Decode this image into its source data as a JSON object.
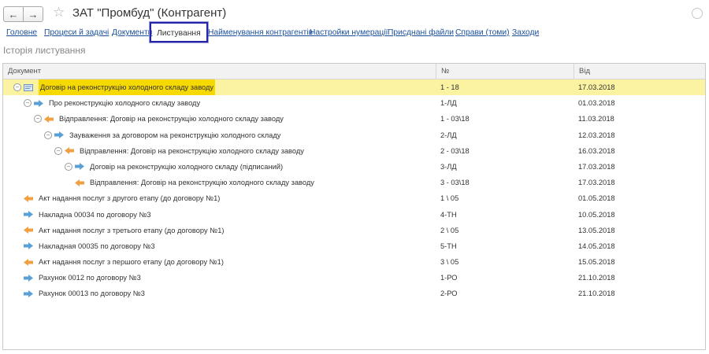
{
  "window": {
    "title": "ЗАТ \"Промбуд\" (Контрагент)",
    "back_icon": "arrow-left-icon",
    "forward_icon": "arrow-right-icon",
    "favorite_icon": "star-icon"
  },
  "tabs": [
    {
      "label": "Головне",
      "active": false
    },
    {
      "label": "Процеси й задачі",
      "active": false
    },
    {
      "label": "Документи",
      "active": false
    },
    {
      "label": "Листування",
      "active": true
    },
    {
      "label": "Найменування контрагентів",
      "active": false
    },
    {
      "label": "Настройки нумерації",
      "active": false
    },
    {
      "label": "Присднані файли",
      "active": false
    },
    {
      "label": "Справи (томи)",
      "active": false
    },
    {
      "label": "Заходи",
      "active": false
    }
  ],
  "section_title": "Історія листування",
  "table": {
    "columns": [
      "Документ",
      "№",
      "Від"
    ],
    "rows": [
      {
        "level": 0,
        "toggle": "collapse",
        "icon": "document-icon",
        "document": "Договір на реконструкцію холодного складу заводу",
        "number": "1 - 18",
        "date": "17.03.2018",
        "selected": true
      },
      {
        "level": 1,
        "toggle": "collapse",
        "icon": "incoming-arrow-icon",
        "document": "Про реконструкцію холодного складу заводу",
        "number": "1-ЛД",
        "date": "01.03.2018",
        "selected": false
      },
      {
        "level": 2,
        "toggle": "collapse",
        "icon": "outgoing-arrow-icon",
        "document": "Відправлення: Договір на реконструкцію холодного складу заводу",
        "number": "1 - 03\\18",
        "date": "11.03.2018",
        "selected": false
      },
      {
        "level": 3,
        "toggle": "collapse",
        "icon": "incoming-arrow-icon",
        "document": "Зауваження за договором на реконструкцію холодного складу",
        "number": "2-ЛД",
        "date": "12.03.2018",
        "selected": false
      },
      {
        "level": 4,
        "toggle": "collapse",
        "icon": "outgoing-arrow-icon",
        "document": "Відправлення: Договір на реконструкцію холодного складу заводу",
        "number": "2 - 03\\18",
        "date": "16.03.2018",
        "selected": false
      },
      {
        "level": 5,
        "toggle": "collapse",
        "icon": "incoming-arrow-icon",
        "document": "Договір на реконструкцію холодного складу (підписаний)",
        "number": "3-ЛД",
        "date": "17.03.2018",
        "selected": false
      },
      {
        "level": 6,
        "toggle": "none",
        "icon": "outgoing-arrow-icon",
        "document": "Відправлення: Договір на реконструкцію холодного складу заводу",
        "number": "3 - 03\\18",
        "date": "17.03.2018",
        "selected": false
      },
      {
        "level": 1,
        "toggle": "none",
        "icon": "outgoing-arrow-icon",
        "document": "Акт надання послуг з другого етапу (до договору №1)",
        "number": "1 \\ 05",
        "date": "01.05.2018",
        "selected": false
      },
      {
        "level": 1,
        "toggle": "none",
        "icon": "incoming-arrow-icon",
        "document": "Накладна 00034 по договору №3",
        "number": "4-ТН",
        "date": "10.05.2018",
        "selected": false
      },
      {
        "level": 1,
        "toggle": "none",
        "icon": "outgoing-arrow-icon",
        "document": "Акт надання послуг з третього етапу (до договору №1)",
        "number": "2 \\ 05",
        "date": "13.05.2018",
        "selected": false
      },
      {
        "level": 1,
        "toggle": "none",
        "icon": "incoming-arrow-icon",
        "document": "Накладная 00035 по договору №3",
        "number": "5-ТН",
        "date": "14.05.2018",
        "selected": false
      },
      {
        "level": 1,
        "toggle": "none",
        "icon": "outgoing-arrow-icon",
        "document": "Акт надання послуг з першого етапу (до договору №1)",
        "number": "3 \\ 05",
        "date": "15.05.2018",
        "selected": false
      },
      {
        "level": 1,
        "toggle": "none",
        "icon": "incoming-arrow-icon",
        "document": "Рахунок 0012 по договору №3",
        "number": "1-РО",
        "date": "21.10.2018",
        "selected": false
      },
      {
        "level": 1,
        "toggle": "none",
        "icon": "incoming-arrow-icon",
        "document": "Рахунок 00013 по договору №3",
        "number": "2-РО",
        "date": "21.10.2018",
        "selected": false
      }
    ]
  },
  "colors": {
    "link": "#1b4f9c",
    "selected_row": "#fbf2a2",
    "selected_text_highlight": "#f6d900",
    "incoming_arrow": "#5aa0d6",
    "outgoing_arrow": "#f0a040",
    "active_tab_border": "#2424a8"
  }
}
